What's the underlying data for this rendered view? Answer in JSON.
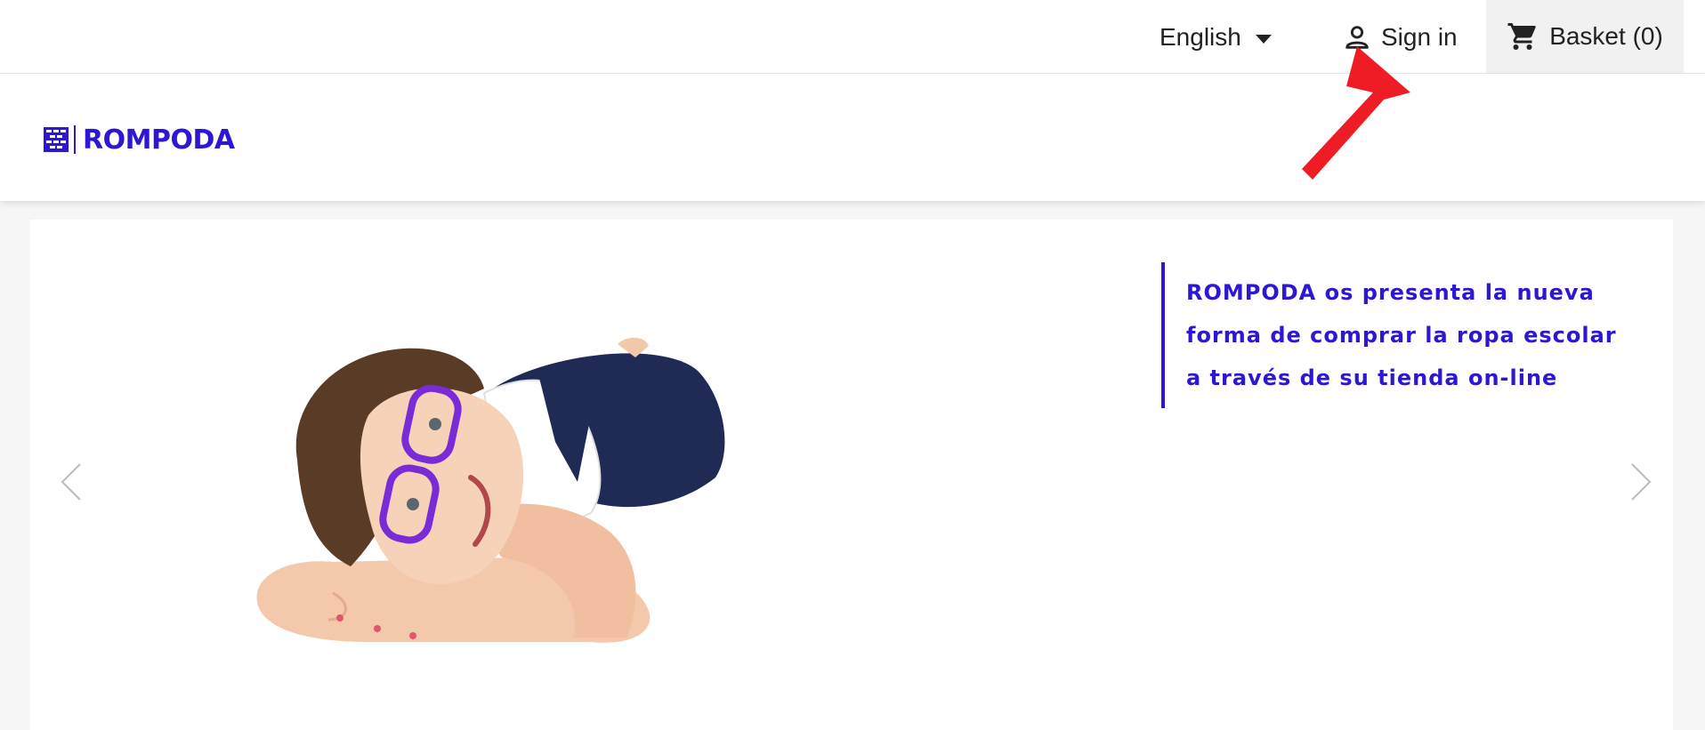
{
  "nav": {
    "language": "English",
    "sign_in": "Sign in",
    "basket": "Basket (0)"
  },
  "brand": {
    "name": "ROMPODA",
    "color": "#2b17d4"
  },
  "slide": {
    "lines": [
      "ROMPODA os presenta la nueva",
      "forma de comprar la ropa escolar",
      "a través de su tienda on-line"
    ]
  },
  "icons": {
    "language_caret": "caret-down-icon",
    "user": "user-icon",
    "cart": "cart-icon",
    "prev": "chevron-left-icon",
    "next": "chevron-right-icon"
  },
  "annotation_color": "#ee1c25"
}
